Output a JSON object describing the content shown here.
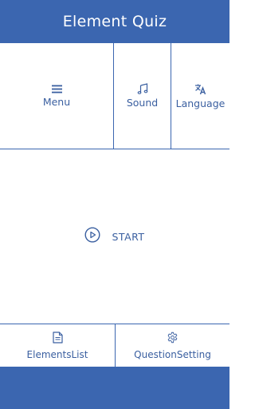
{
  "header": {
    "title": "Element Quiz"
  },
  "top_menu": {
    "menu_label": "Menu",
    "sound_label": "Sound",
    "language_label": "Language"
  },
  "start": {
    "label": "START"
  },
  "bottom_menu": {
    "elements_list_label": "ElementsList",
    "question_setting_label": "QuestionSetting"
  },
  "colors": {
    "primary": "#3b66b0",
    "text": "#3a5fa0",
    "background": "#ffffff"
  },
  "icons": {
    "menu": "menu-icon",
    "sound": "music-note-icon",
    "language": "translate-icon",
    "start": "play-circle-icon",
    "elements_list": "document-icon",
    "question_setting": "gear-icon"
  }
}
